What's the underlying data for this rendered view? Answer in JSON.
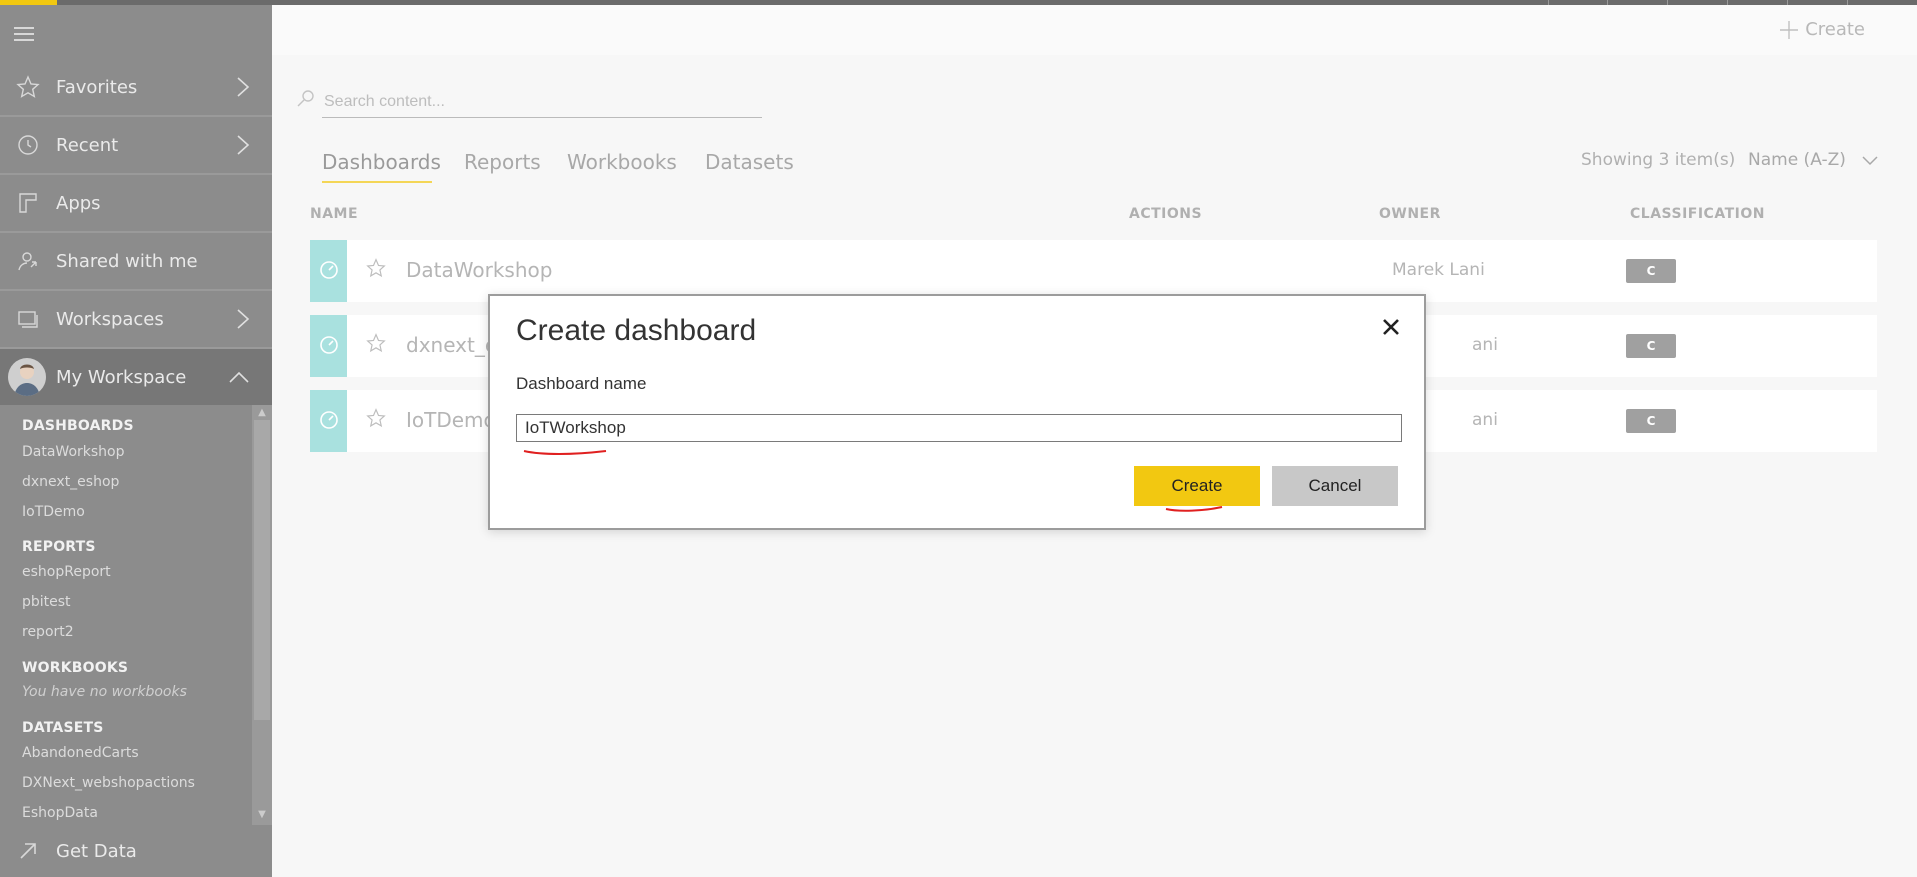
{
  "sidebar": {
    "nav": [
      {
        "label": "Favorites",
        "icon": "star-icon"
      },
      {
        "label": "Recent",
        "icon": "clock-icon"
      },
      {
        "label": "Apps",
        "icon": "apps-icon"
      },
      {
        "label": "Shared with me",
        "icon": "shared-icon"
      },
      {
        "label": "Workspaces",
        "icon": "workspaces-icon"
      },
      {
        "label": "My Workspace",
        "icon": "avatar"
      }
    ],
    "sections": {
      "dashboards": {
        "title": "DASHBOARDS",
        "items": [
          "DataWorkshop",
          "dxnext_eshop",
          "IoTDemo"
        ]
      },
      "reports": {
        "title": "REPORTS",
        "items": [
          "eshopReport",
          "pbitest",
          "report2"
        ]
      },
      "workbooks": {
        "title": "WORKBOOKS",
        "empty": "You have no workbooks"
      },
      "datasets": {
        "title": "DATASETS",
        "items": [
          "AbandonedCarts",
          "DXNext_webshopactions",
          "EshopData"
        ]
      }
    },
    "get_data": "Get Data"
  },
  "header": {
    "create_label": "Create"
  },
  "search": {
    "placeholder": "Search content..."
  },
  "tabs": [
    "Dashboards",
    "Reports",
    "Workbooks",
    "Datasets"
  ],
  "showing": "Showing 3 item(s)",
  "sort": "Name (A-Z)",
  "columns": {
    "name": "NAME",
    "actions": "ACTIONS",
    "owner": "OWNER",
    "classification": "CLASSIFICATION"
  },
  "rows": [
    {
      "name": "DataWorkshop",
      "owner": "Marek Lani",
      "classification": "C"
    },
    {
      "name": "dxnext_es",
      "owner": "ani",
      "classification": "C"
    },
    {
      "name": "IoTDemo",
      "owner": "ani",
      "classification": "C"
    }
  ],
  "modal": {
    "title": "Create dashboard",
    "field_label": "Dashboard name",
    "field_value": "IoTWorkshop",
    "create_label": "Create",
    "cancel_label": "Cancel"
  },
  "colors": {
    "accent": "#f2c811",
    "tile": "#a9e1df",
    "sidebar": "#8c8c8c"
  }
}
